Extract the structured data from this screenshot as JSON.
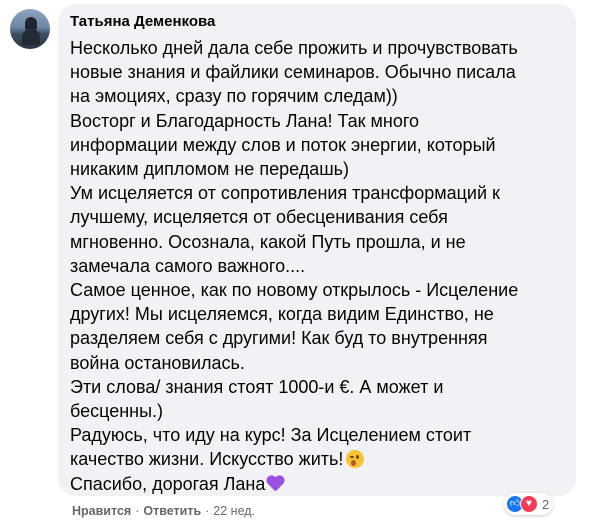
{
  "comment": {
    "author": "Татьяна Деменкова",
    "lines": [
      "Несколько дней дала себе прожить и прочувствовать",
      "новые знания и файлики семинаров. Обычно писала",
      "на эмоциях, сразу по горячим следам))",
      "Восторг и Благодарность Лана! Так много",
      "информации между слов и поток энергии, который",
      "никаким дипломом не передашь)",
      "Ум исцеляется от сопротивления трансформаций к",
      "лучшему, исцеляется от обесценивания себя",
      "мгновенно. Осознала, какой Путь прошла, и не",
      "замечала самого важного....",
      "Самое ценное, как по новому открылось - Исцеление",
      "других! Мы исцеляемся, когда видим Единство, не",
      "разделяем себя с другими! Как буд то внутренняя",
      "война остановилась.",
      "Эти слова/ знания стоят 1000-и €. А может и",
      "бесценны.)",
      "Радуюсь, что иду на курс! За Исцелением стоит",
      "качество жизни. Искусство жить!",
      "Спасибо, дорогая Лана"
    ],
    "emojis": {
      "line18": "winking-face-icon",
      "line19": "purple-heart-icon"
    }
  },
  "actions": {
    "like": "Нравится",
    "separator": "·",
    "reply": "Ответить",
    "time": "22 нед."
  },
  "reactions": {
    "icons": [
      "like-icon",
      "love-icon"
    ],
    "count": "2"
  },
  "colors": {
    "bubble": "#f0f2f5",
    "text": "#050505",
    "secondary": "#65676b",
    "like": "#1877f2",
    "love": "#f33e58",
    "purple_heart": "#9b4fe0"
  }
}
